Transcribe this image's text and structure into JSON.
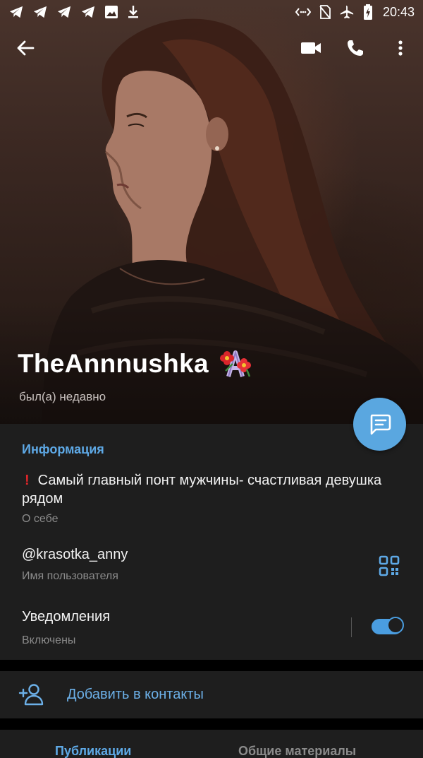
{
  "status_bar": {
    "time": "20:43",
    "left_icons": [
      "telegram-icon",
      "telegram-icon",
      "telegram-icon",
      "telegram-icon",
      "image-icon",
      "download-icon"
    ],
    "right_icons": [
      "data-saver-icon",
      "no-sim-icon",
      "airplane-icon",
      "battery-charging-icon"
    ]
  },
  "toolbar": {
    "back_icon": "arrow-left-icon",
    "video_icon": "video-call-icon",
    "phone_icon": "phone-icon",
    "menu_icon": "more-vert-icon"
  },
  "profile": {
    "name": "TheAnnnushka",
    "name_badge": "flower-emoji-badge",
    "status": "был(а) недавно"
  },
  "info": {
    "section_title": "Информация",
    "bio": "Самый главный понт мужчины- счастливая девушка рядом",
    "bio_label": "О себе",
    "username": "@krasotka_anny",
    "username_label": "Имя пользователя",
    "notifications": "Уведомления",
    "notifications_status": "Включены",
    "notifications_enabled": true
  },
  "add_contact": {
    "label": "Добавить в контакты"
  },
  "tabs": [
    {
      "label": "Публикации",
      "active": true
    },
    {
      "label": "Общие материалы",
      "active": false
    }
  ],
  "colors": {
    "accent": "#5ea9e6",
    "fab": "#5aa7e0",
    "panel": "#1e1e1e",
    "alert": "#e0262a"
  }
}
